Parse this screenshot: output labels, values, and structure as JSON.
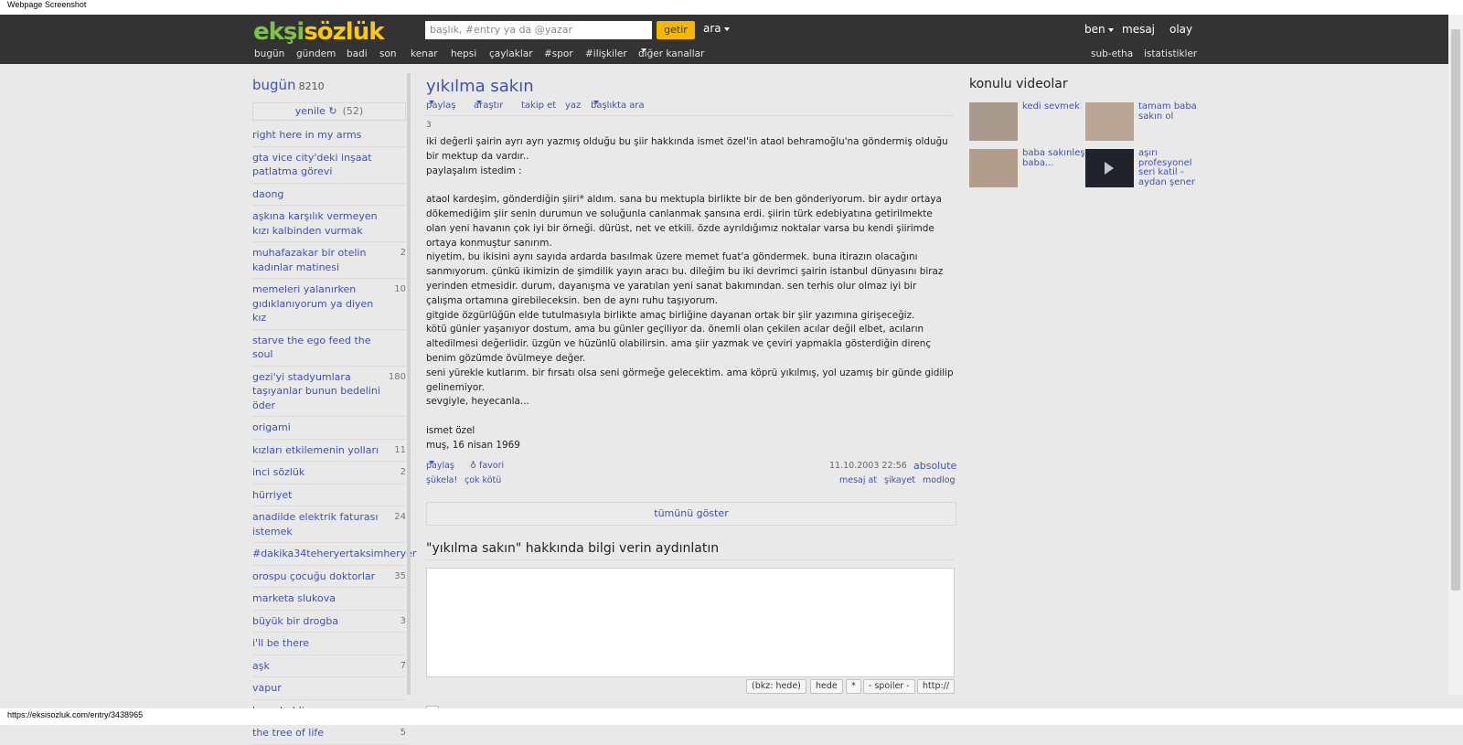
{
  "window": {
    "caption": "Webpage Screenshot"
  },
  "header": {
    "logo_parts": [
      "ekşi",
      "sözlük"
    ],
    "search_placeholder": "başlık, #entry ya da @yazar",
    "getir_label": "getir",
    "ara_label": "ara",
    "user_menu": [
      "ben",
      "mesaj",
      "olay"
    ],
    "channels": [
      "bugün",
      "gündem",
      "badi",
      "son",
      "kenar",
      "hepsi",
      "çaylaklar",
      "#spor",
      "#ilişkiler",
      "diğer kanallar"
    ],
    "subnav": [
      "sub-etha",
      "istatistikler"
    ]
  },
  "sidebar": {
    "title": "bugün",
    "count": "8210",
    "refresh_label": "yenile ↻",
    "refresh_count": "(52)",
    "topics": [
      {
        "title": "right here in my arms",
        "count": ""
      },
      {
        "title": "gta vice city'deki inşaat patlatma görevi",
        "count": ""
      },
      {
        "title": "daong",
        "count": ""
      },
      {
        "title": "aşkına karşılık vermeyen kızı kalbinden vurmak",
        "count": ""
      },
      {
        "title": "muhafazakar bir otelin kadınlar matinesi",
        "count": "2"
      },
      {
        "title": "memeleri yalanırken gıdıklanıyorum ya diyen kız",
        "count": "10"
      },
      {
        "title": "starve the ego feed the soul",
        "count": ""
      },
      {
        "title": "gezi'yi stadyumlara taşıyanlar bunun bedelini öder",
        "count": "180"
      },
      {
        "title": "origami",
        "count": ""
      },
      {
        "title": "kızları etkilemenin yolları",
        "count": "11"
      },
      {
        "title": "inci sözlük",
        "count": "2"
      },
      {
        "title": "hürriyet",
        "count": ""
      },
      {
        "title": "anadilde elektrik faturası istemek",
        "count": "24"
      },
      {
        "title": "#dakika34teheryertaksimheryer",
        "count": ""
      },
      {
        "title": "orospu çocuğu doktorlar",
        "count": "35"
      },
      {
        "title": "marketa slukova",
        "count": ""
      },
      {
        "title": "büyük bir drogba",
        "count": "3"
      },
      {
        "title": "i'll be there",
        "count": ""
      },
      {
        "title": "aşk",
        "count": "7"
      },
      {
        "title": "vapur",
        "count": ""
      },
      {
        "title": "keep holding on",
        "count": ""
      },
      {
        "title": "the tree of life",
        "count": "5"
      }
    ]
  },
  "entry": {
    "title": "yıkılma sakın",
    "actions": [
      "paylaş",
      "araştır",
      "takip et",
      "yaz",
      "başlıkta ara"
    ],
    "number": "3",
    "body": [
      "iki değerli şairin ayrı ayrı yazmış olduğu bu şiir hakkında ismet özel'in ataol behramoğlu'na göndermiş olduğu bir mektup da vardır..",
      "paylaşalım istedim :",
      "",
      "ataol kardeşim, gönderdiğin şiiri* aldım. sana bu mektupla birlikte bir de ben gönderiyorum. bir aydır ortaya dökemediğim şiir senin durumun ve soluğunla canlanmak şansına erdi. şiirin türk edebiyatına getirilmekte olan yeni havanın çok iyi bir örneği. dürüst, net ve etkili. özde ayrıldığımız noktalar varsa bu kendi şiirimde ortaya konmuştur sanırım.",
      "niyetim, bu ikisini aynı sayıda ardarda basılmak üzere memet fuat'a göndermek. buna itirazın olacağını sanmıyorum. çünkü ikimizin de şimdilik yayın aracı bu. dileğim bu iki devrimci şairin istanbul dünyasını biraz yerinden etmesidir. durum, dayanışma ve yaratılan yeni sanat bakımından. sen terhis olur olmaz iyi bir çalışma ortamına girebileceksin. ben de aynı ruhu taşıyorum.",
      "gitgide özgürlüğün elde tutulmasıyla birlikte amaç birliğine dayanan ortak bir şiir yazımına girişeceğiz.",
      "kötü günler yaşanıyor dostum, ama bu günler geçiliyor da. önemli olan çekilen acılar değil elbet, acıların altedilmesi değerlidir. üzgün ve hüzünlü olabilirsin. ama şiir yazmak ve çeviri yapmakla gösterdiğin direnç benim gözümde övülmeye değer.",
      "seni yürekle kutlarım. bir fırsatı olsa seni görmeğe gelecektim. ama köprü yıkılmış, yol uzamış bir günde gidilip gelinemiyor.",
      "sevgiyle, heyecanla...",
      "",
      "ismet özel",
      "muş, 16 nisan 1969"
    ],
    "footer": {
      "share": "paylaş",
      "favorite": "♁ favori",
      "sukela": "şükela!",
      "cok_kotu": "çok kötü",
      "date": "11.10.2003 22:56",
      "author": "absolute",
      "message": "mesaj at",
      "complaint": "şikayet",
      "modlog": "modlog"
    },
    "show_all": "tümünü göster"
  },
  "form": {
    "title": "\"yıkılma sakın\" hakkında bilgi verin aydınlatın",
    "buttons": [
      "(bkz: hede)",
      "hede",
      "*",
      "- spoiler -",
      "http://"
    ]
  },
  "videos": {
    "title": "konulu videolar",
    "items": [
      {
        "title": "kedi sevmek"
      },
      {
        "title": "tamam baba sakın ol"
      },
      {
        "title": "baba sakınleş baba..."
      },
      {
        "title": "aşırı profesyonel seri katil - aydan şener"
      }
    ]
  },
  "statusbar": {
    "url": "https://eksisozluk.com/entry/3438965"
  }
}
